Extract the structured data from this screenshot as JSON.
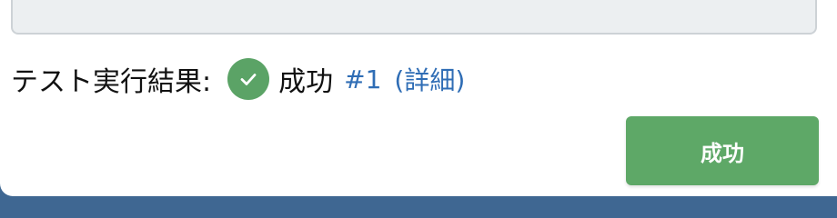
{
  "test_result": {
    "label": "テスト実行結果:",
    "status_icon": "check-circle-icon",
    "status_text": "成功",
    "run_link": "#1",
    "details_link": "(詳細)"
  },
  "actions": {
    "success_button": "成功"
  },
  "colors": {
    "success": "#5ea867",
    "link": "#2f6db5",
    "background": "#3f6792"
  }
}
